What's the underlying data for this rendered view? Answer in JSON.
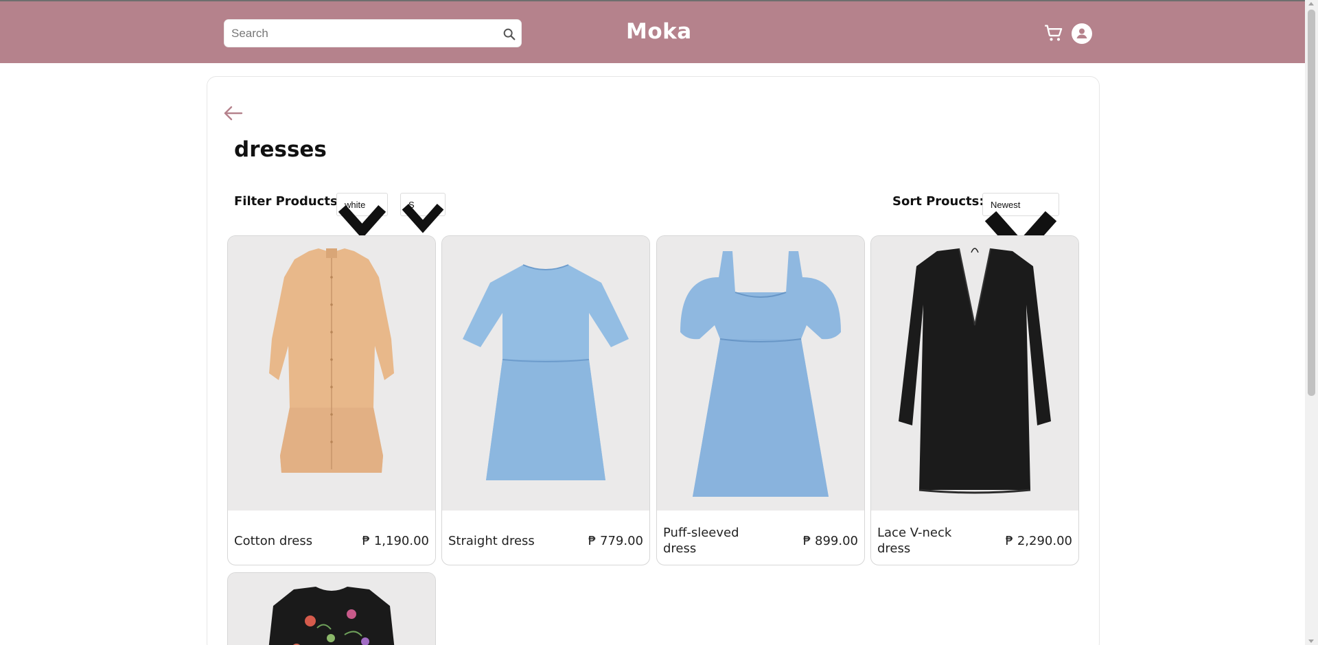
{
  "header": {
    "search_placeholder": "Search",
    "logo": "Moka",
    "background_color": "#b5828c"
  },
  "page": {
    "title": "dresses",
    "filter_label": "Filter Products:",
    "color_filter": "white",
    "size_filter": "S",
    "sort_label": "Sort Proucts:",
    "sort_value": "Newest"
  },
  "products": [
    {
      "name": "Cotton dress",
      "price": "₱ 1,190.00",
      "image_icon": "dress-beige-image"
    },
    {
      "name": "Straight dress",
      "price": "₱ 779.00",
      "image_icon": "dress-denim-image"
    },
    {
      "name": "Puff-sleeved dress",
      "price": "₱ 899.00",
      "image_icon": "dress-puff-denim-image"
    },
    {
      "name": "Lace V-neck dress",
      "price": "₱ 2,290.00",
      "image_icon": "dress-black-lace-image"
    },
    {
      "image_icon": "dress-floral-black-image"
    }
  ]
}
